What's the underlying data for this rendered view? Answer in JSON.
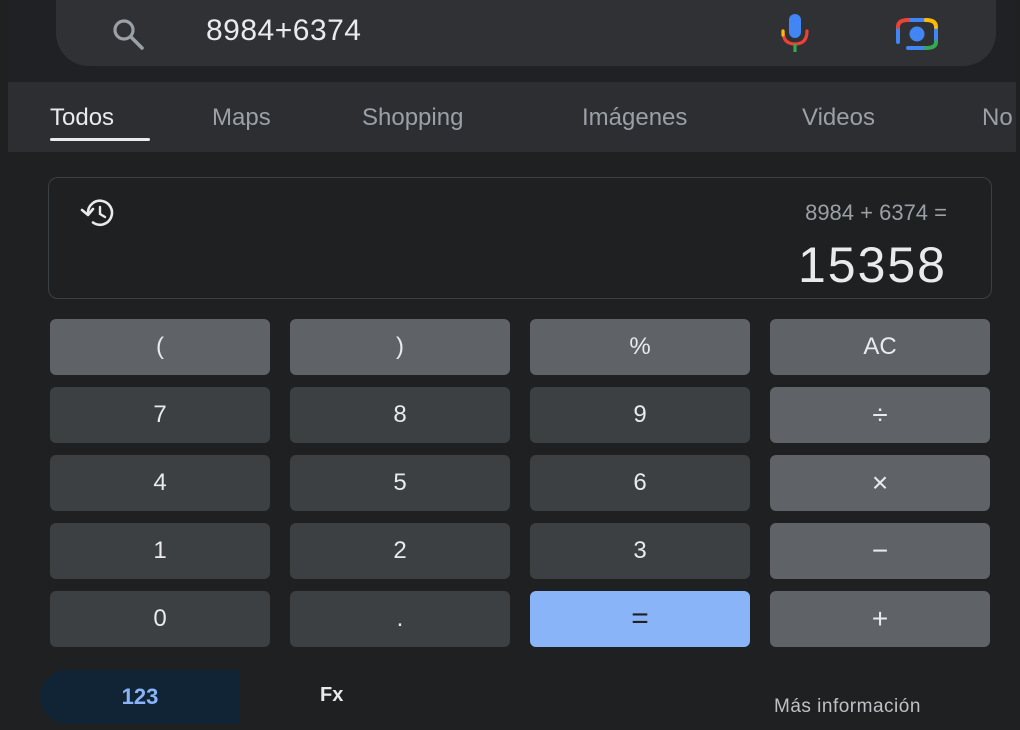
{
  "search": {
    "query": "8984+6374",
    "icons": [
      "search-icon",
      "mic-icon",
      "lens-icon"
    ]
  },
  "tabs": [
    {
      "label": "Todos",
      "active": true
    },
    {
      "label": "Maps",
      "active": false
    },
    {
      "label": "Shopping",
      "active": false
    },
    {
      "label": "Imágenes",
      "active": false
    },
    {
      "label": "Videos",
      "active": false
    },
    {
      "label": "No",
      "active": false
    }
  ],
  "calculator": {
    "expression": "8984 + 6374 =",
    "result": "15358",
    "keys": [
      [
        "(",
        ")",
        "%",
        "AC"
      ],
      [
        "7",
        "8",
        "9",
        "÷"
      ],
      [
        "4",
        "5",
        "6",
        "×"
      ],
      [
        "1",
        "2",
        "3",
        "−"
      ],
      [
        "0",
        ".",
        "=",
        "+"
      ]
    ]
  },
  "footer": {
    "mode_basic": "123",
    "mode_fx": "Fx",
    "more_info": "Más información"
  },
  "colors": {
    "accent": "#8ab4f8",
    "key_function": "#5f6368",
    "key_number": "#3c4043",
    "background": "#1f2021"
  }
}
